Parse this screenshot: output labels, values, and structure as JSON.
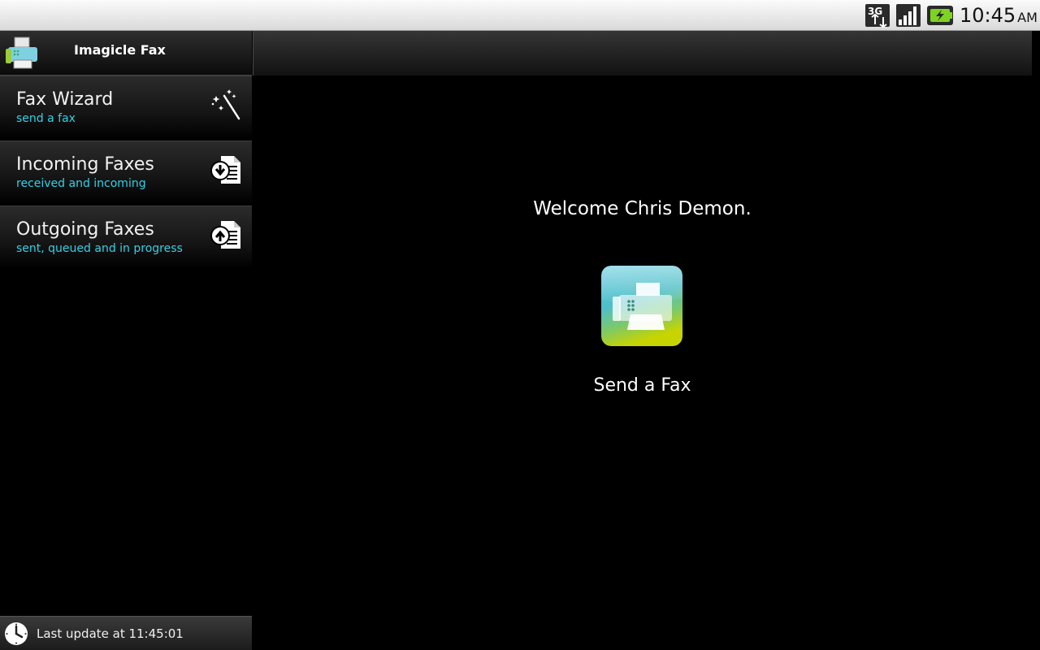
{
  "status_bar": {
    "network_label": "3G",
    "network_icon": "3g-data-icon",
    "signal_icon": "signal-strength-icon",
    "battery_icon": "battery-charging-icon",
    "time": "10:45",
    "ampm": "AM"
  },
  "app": {
    "title": "Imagicle Fax",
    "logo_icon": "fax-machine-icon"
  },
  "menu": [
    {
      "title": "Fax Wizard",
      "subtitle": "send a fax",
      "icon": "magic-wand-icon"
    },
    {
      "title": "Incoming Faxes",
      "subtitle": "received and incoming",
      "icon": "incoming-document-icon"
    },
    {
      "title": "Outgoing Faxes",
      "subtitle": "sent, queued and in progress",
      "icon": "outgoing-document-icon"
    }
  ],
  "footer": {
    "icon": "clock-icon",
    "text": "Last update at 11:45:01"
  },
  "main": {
    "welcome": "Welcome Chris Demon.",
    "send_fax_label": "Send a Fax",
    "send_fax_icon": "fax-machine-icon"
  },
  "colors": {
    "subtitle": "#33d1e6",
    "background": "#000000",
    "status_bar": "#e6e6e6"
  }
}
